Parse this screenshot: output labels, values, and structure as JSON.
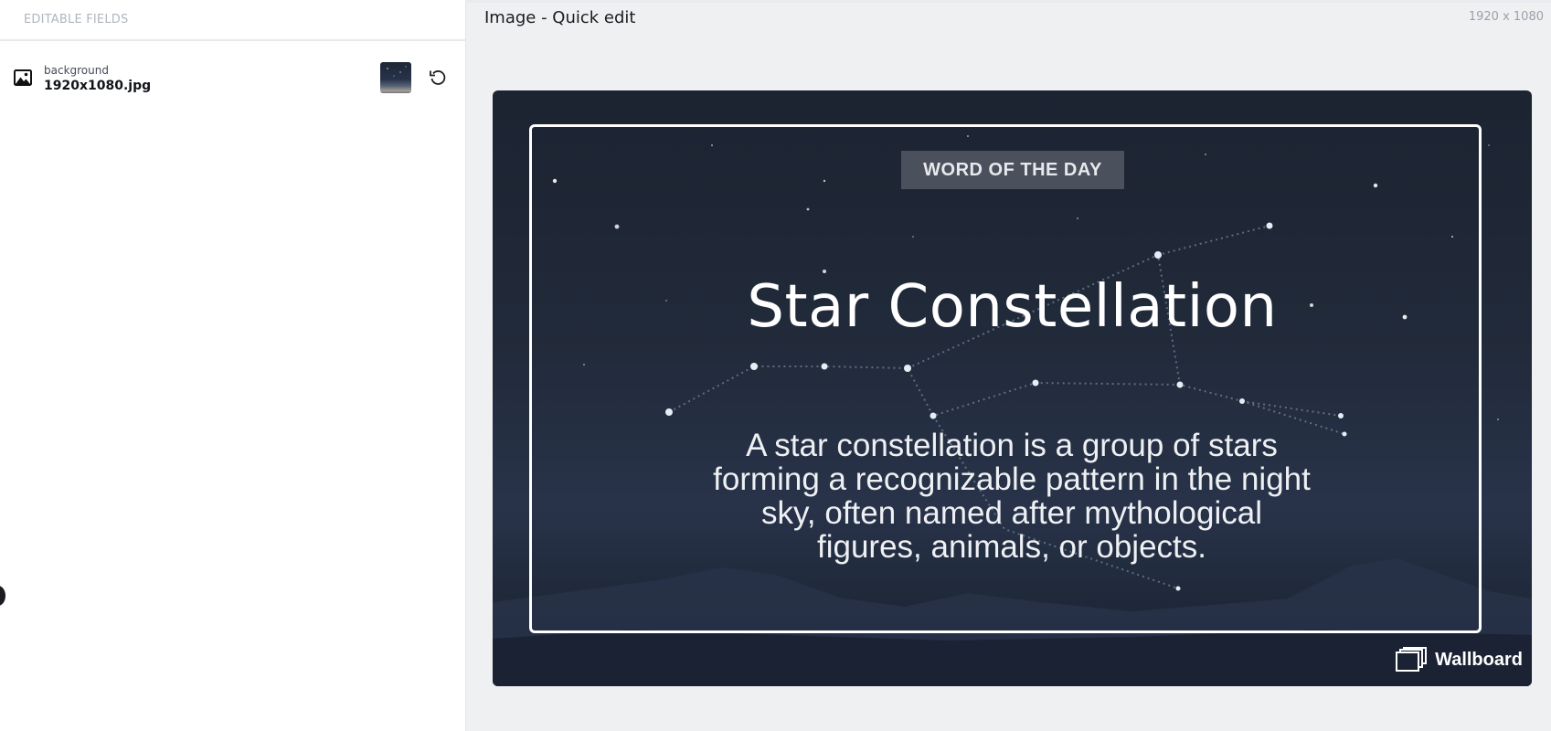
{
  "left_panel": {
    "header": "EDITABLE FIELDS",
    "fields": [
      {
        "name": "background",
        "value": "1920x1080.jpg",
        "icon": "image-icon"
      }
    ]
  },
  "editor": {
    "title": "Image - Quick edit",
    "dimensions": "1920 x 1080"
  },
  "preview": {
    "badge": "WORD OF THE DAY",
    "headline": "Star Constellation",
    "description_lines": [
      "A star constellation is a group of stars",
      "forming a recognizable pattern in the night",
      "sky, often named after mythological",
      "figures, animals, or objects."
    ],
    "brand": "Wallboard"
  },
  "colors": {
    "panel_background": "#eff0f2",
    "sky_top": "#1c2331",
    "sky_bottom": "#182132",
    "badge_background": "#4a505c",
    "frame": "#ffffff"
  }
}
